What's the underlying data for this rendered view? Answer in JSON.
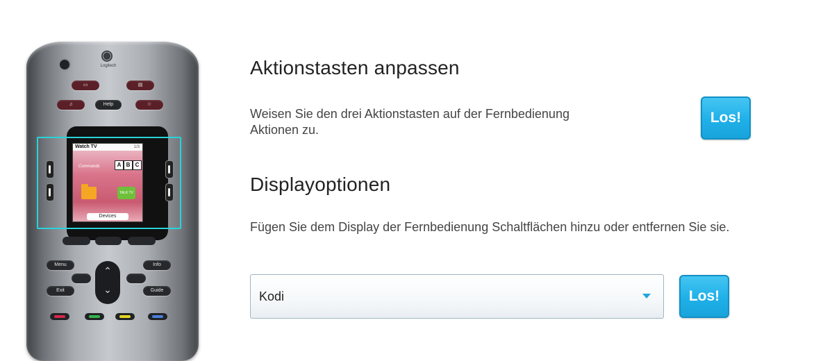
{
  "remote": {
    "brand": "Logitech",
    "screen_title": "Watch TV",
    "screen_page": "1/3",
    "screen_label": "Commands",
    "abc": [
      "A",
      "B",
      "C"
    ],
    "tv_label": "TALK TV",
    "devices_label": "Devices",
    "buttons": {
      "help": "Help",
      "menu": "Menu",
      "info": "Info",
      "exit": "Exit",
      "guide": "Guide"
    }
  },
  "section1": {
    "title": "Aktionstasten anpassen",
    "description": "Weisen Sie den drei Aktionstasten auf der Fernbedienung Aktionen zu.",
    "button": "Los!"
  },
  "section2": {
    "title": "Displayoptionen",
    "description": "Fügen Sie dem Display der Fernbedienung Schaltflächen hinzu oder entfernen Sie sie.",
    "select_value": "Kodi",
    "button": "Los!"
  },
  "colors": {
    "accent": "#1fb0e8",
    "highlight": "#27d4da"
  }
}
